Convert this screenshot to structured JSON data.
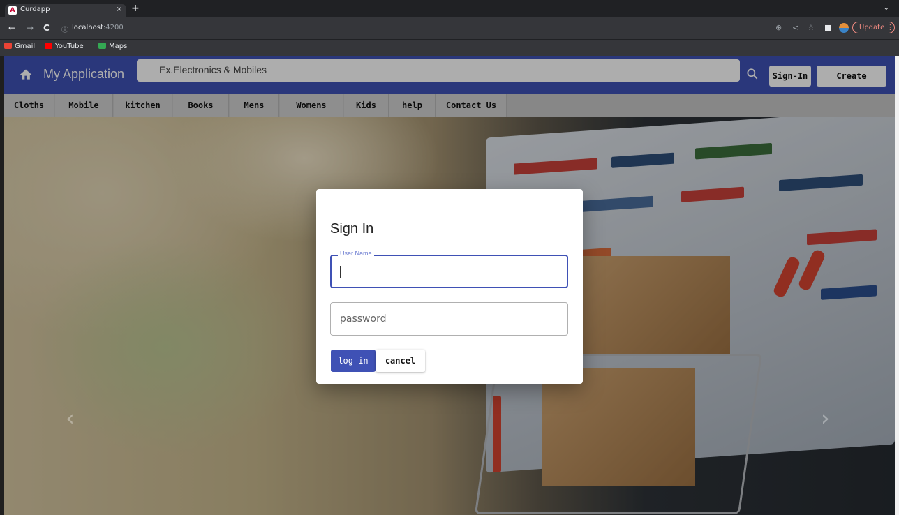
{
  "browser": {
    "tab": {
      "title": "Curdapp",
      "favicon": "A",
      "close": "×"
    },
    "new_tab": "+",
    "tab_menu": "⌄",
    "url": {
      "host": "localhost",
      "port": ":4200"
    },
    "nav": {
      "back": "←",
      "forward": "→",
      "reload": "C",
      "info": "ⓘ"
    },
    "toolbar_icons": {
      "zoom": "⊕",
      "share": "<",
      "star": "☆",
      "sidepanel": "■"
    },
    "update_label": "Update ⋮",
    "bookmarks": [
      {
        "label": "Gmail",
        "color": "#ea4335"
      },
      {
        "label": "YouTube",
        "color": "#ff0000"
      },
      {
        "label": "Maps",
        "color": "#34a853"
      }
    ]
  },
  "app": {
    "title": "My Application",
    "search_placeholder": "Ex.Electronics & Mobiles",
    "signin_label": "Sign-In",
    "create_account_label": "Create Account",
    "accent_color": "#3f51b5",
    "categories": [
      "Cloths",
      "Mobile",
      "kitchen",
      "Books",
      "Mens",
      "Womens",
      "Kids",
      "help",
      "Contact Us"
    ]
  },
  "carousel": {
    "prev": "‹",
    "next": "›"
  },
  "dialog": {
    "title": "Sign In",
    "username_label": "User Name",
    "username_value": "",
    "password_placeholder": "password",
    "login_label": "log in",
    "cancel_label": "cancel"
  }
}
